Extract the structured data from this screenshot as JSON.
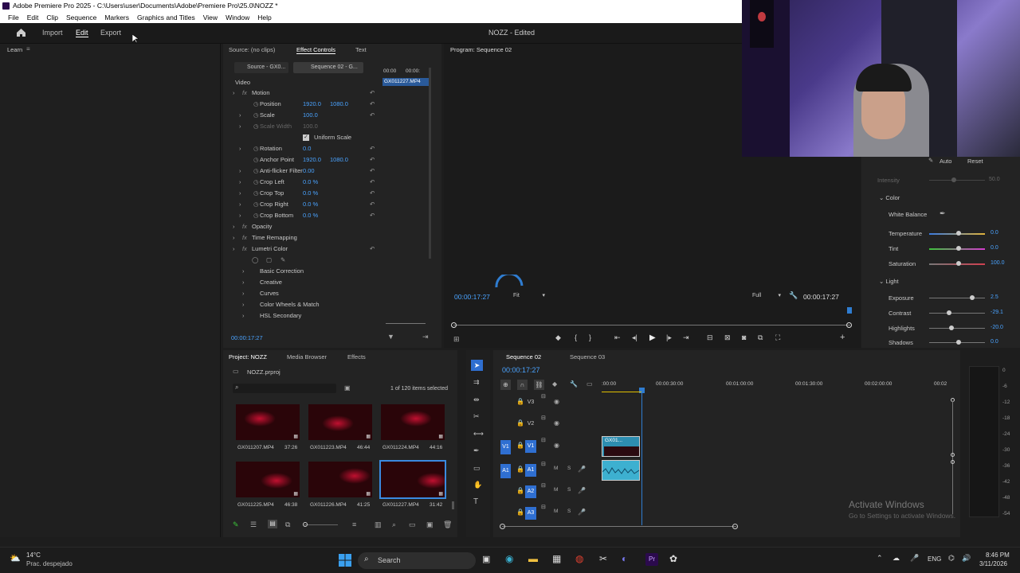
{
  "window": {
    "title": "Adobe Premiere Pro 2025 - C:\\Users\\user\\Documents\\Adobe\\Premiere Pro\\25.0\\NOZZ *"
  },
  "menu": [
    "File",
    "Edit",
    "Clip",
    "Sequence",
    "Markers",
    "Graphics and Titles",
    "View",
    "Window",
    "Help"
  ],
  "topbar": {
    "import": "Import",
    "edit": "Edit",
    "export": "Export",
    "project_title": "NOZZ - Edited"
  },
  "learn": {
    "title": "Learn"
  },
  "effect_controls": {
    "tabs": [
      "Source: (no clips)",
      "Effect Controls",
      "Text"
    ],
    "source_tab": "Source - GX0...",
    "sequence_tab": "Sequence 02 - G...",
    "clip_name": "GX011227.MP4",
    "timecode_a": "00:00",
    "timecode_b": "00:00:",
    "section_video": "Video",
    "rows": [
      {
        "label": "Motion",
        "v1": "",
        "v2": ""
      },
      {
        "label": "Position",
        "v1": "1920.0",
        "v2": "1080.0"
      },
      {
        "label": "Scale",
        "v1": "100.0",
        "v2": ""
      },
      {
        "label": "Scale Width",
        "v1": "100.0",
        "v2": ""
      },
      {
        "label": "Uniform Scale",
        "v1": "",
        "v2": ""
      },
      {
        "label": "Rotation",
        "v1": "0.0",
        "v2": ""
      },
      {
        "label": "Anchor Point",
        "v1": "1920.0",
        "v2": "1080.0"
      },
      {
        "label": "Anti-flicker Filter",
        "v1": "0.00",
        "v2": ""
      },
      {
        "label": "Crop Left",
        "v1": "0.0 %",
        "v2": ""
      },
      {
        "label": "Crop Top",
        "v1": "0.0 %",
        "v2": ""
      },
      {
        "label": "Crop Right",
        "v1": "0.0 %",
        "v2": ""
      },
      {
        "label": "Crop Bottom",
        "v1": "0.0 %",
        "v2": ""
      },
      {
        "label": "Opacity",
        "v1": "",
        "v2": ""
      },
      {
        "label": "Time Remapping",
        "v1": "",
        "v2": ""
      },
      {
        "label": "Lumetri Color",
        "v1": "",
        "v2": ""
      }
    ],
    "lumetri_sub": [
      "Basic Correction",
      "Creative",
      "Curves",
      "Color Wheels & Match",
      "HSL Secondary"
    ],
    "bottom_timecode": "00:00:17:27"
  },
  "program": {
    "title": "Program: Sequence 02",
    "timecode": "00:00:17:27",
    "fit": "Fit",
    "full": "Full",
    "duration": "00:00:17:27"
  },
  "lumetri_panel": {
    "auto": "Auto",
    "reset": "Reset",
    "intensity_label": "Intensity",
    "intensity_value": "50.0",
    "color_section": "Color",
    "white_balance": "White Balance",
    "temperature": {
      "label": "Temperature",
      "value": "0.0"
    },
    "tint": {
      "label": "Tint",
      "value": "0.0"
    },
    "saturation": {
      "label": "Saturation",
      "value": "100.0"
    },
    "light_section": "Light",
    "exposure": {
      "label": "Exposure",
      "value": "2.5"
    },
    "contrast": {
      "label": "Contrast",
      "value": "-29.1"
    },
    "highlights": {
      "label": "Highlights",
      "value": "-20.0"
    },
    "shadows": {
      "label": "Shadows",
      "value": "0.0"
    }
  },
  "project": {
    "tabs": [
      "Project: NOZZ",
      "Media Browser",
      "Effects"
    ],
    "file": "NOZZ.prproj",
    "selection": "1 of 120 items selected",
    "clips": [
      {
        "name": "GX011207.MP4",
        "duration": "37:26"
      },
      {
        "name": "GX011223.MP4",
        "duration": "46:44"
      },
      {
        "name": "GX011224.MP4",
        "duration": "44:16"
      },
      {
        "name": "GX011225.MP4",
        "duration": "46:38"
      },
      {
        "name": "GX011226.MP4",
        "duration": "41:25"
      },
      {
        "name": "GX011227.MP4",
        "duration": "31:42"
      }
    ]
  },
  "timeline": {
    "tabs": [
      "Sequence 02",
      "Sequence 03"
    ],
    "timecode": "00:00:17:27",
    "ruler": [
      ":00:00",
      "00:00:30:00",
      "00:01:00:00",
      "00:01:30:00",
      "00:02:00:00",
      "00:02"
    ],
    "tracks": [
      "V3",
      "V2",
      "V1",
      "A1",
      "A2",
      "A3"
    ],
    "clip_label": "GX01...",
    "meter_scale": [
      "0",
      "-6",
      "-12",
      "-18",
      "-24",
      "-30",
      "-36",
      "-42",
      "-48",
      "-54"
    ]
  },
  "watermark": {
    "line1": "Activate Windows",
    "line2": "Go to Settings to activate Windows."
  },
  "taskbar": {
    "weather_temp": "14°C",
    "weather_desc": "Prac. despejado",
    "search": "Search",
    "lang": "ENG",
    "time": "8:46 PM",
    "date": "3/11/2026"
  }
}
